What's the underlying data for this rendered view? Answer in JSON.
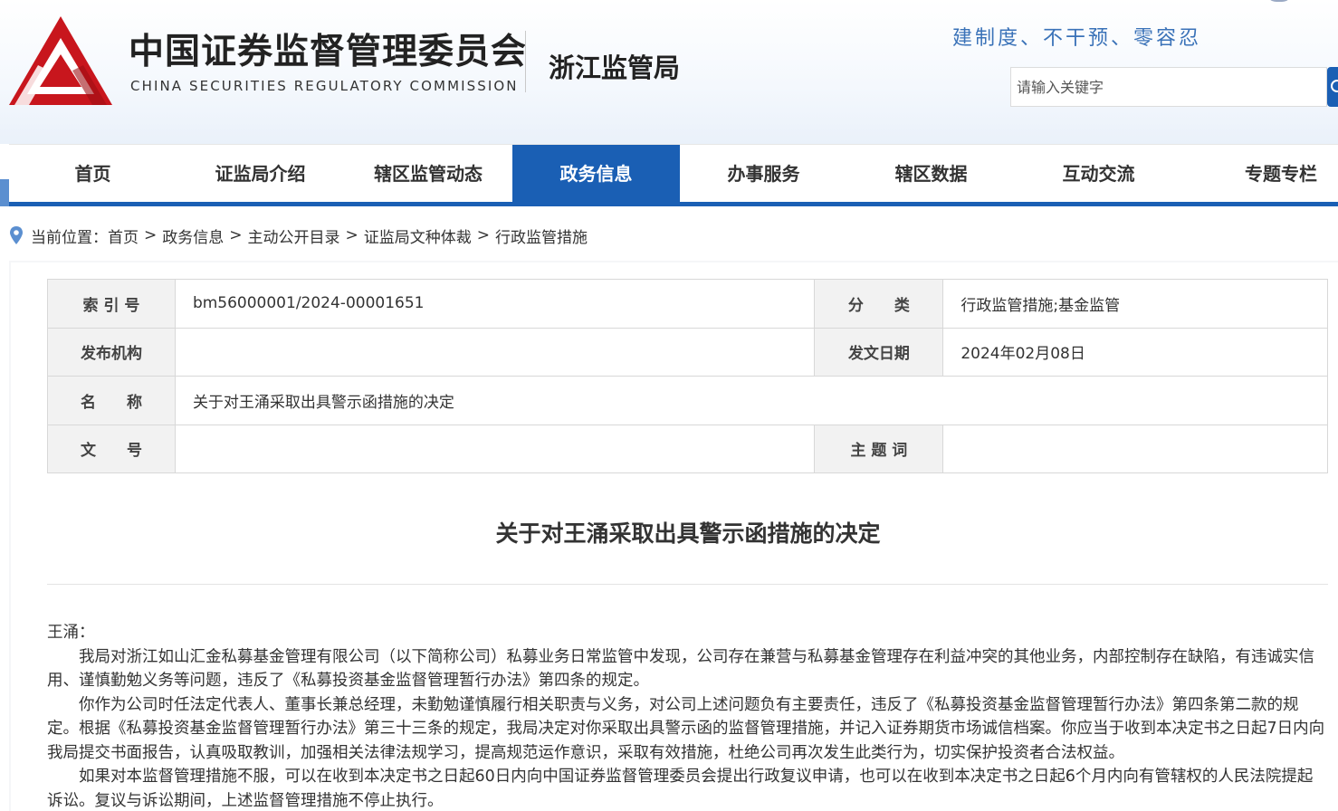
{
  "header": {
    "org_name_cn": "中国证券监督管理委员会",
    "org_name_en": "CHINA SECURITIES REGULATORY COMMISSION",
    "bureau": "浙江监管局",
    "slogan": "建制度、不干预、零容忍",
    "search_placeholder": "请输入关键字",
    "brand_red": "#c8161d",
    "accent_blue": "#1a5fb4"
  },
  "nav": {
    "items": [
      {
        "label": "首页"
      },
      {
        "label": "证监局介绍"
      },
      {
        "label": "辖区监管动态"
      },
      {
        "label": "政务信息",
        "active": true
      },
      {
        "label": "办事服务"
      },
      {
        "label": "辖区数据"
      },
      {
        "label": "互动交流"
      },
      {
        "label": "专题专栏"
      }
    ]
  },
  "breadcrumb": {
    "prefix": "当前位置：",
    "items": [
      "首页",
      "政务信息",
      "主动公开目录",
      "证监局文种体裁",
      "行政监管措施"
    ],
    "separator": ">"
  },
  "info_table": {
    "index_label": "索 引 号",
    "index_value": "bm56000001/2024-00001651",
    "category_label": "分　　类",
    "category_value": "行政监管措施;基金监管",
    "publisher_label": "发布机构",
    "publisher_value": "",
    "date_label": "发文日期",
    "date_value": "2024年02月08日",
    "name_label": "名　　称",
    "name_value": "关于对王涌采取出具警示函措施的决定",
    "docno_label": "文　　号",
    "docno_value": "",
    "keywords_label": "主 题 词",
    "keywords_value": ""
  },
  "article": {
    "title": "关于对王涌采取出具警示函措施的决定",
    "salutation": "王涌：",
    "paragraphs": [
      "我局对浙江如山汇金私募基金管理有限公司（以下简称公司）私募业务日常监管中发现，公司存在兼营与私募基金管理存在利益冲突的其他业务，内部控制存在缺陷，有违诚实信用、谨慎勤勉义务等问题，违反了《私募投资基金监督管理暂行办法》第四条的规定。",
      "你作为公司时任法定代表人、董事长兼总经理，未勤勉谨慎履行相关职责与义务，对公司上述问题负有主要责任，违反了《私募投资基金监督管理暂行办法》第四条第二款的规定。根据《私募投资基金监督管理暂行办法》第三十三条的规定，我局决定对你采取出具警示函的监督管理措施，并记入证券期货市场诚信档案。你应当于收到本决定书之日起7日内向我局提交书面报告，认真吸取教训，加强相关法律法规学习，提高规范运作意识，采取有效措施，杜绝公司再次发生此类行为，切实保护投资者合法权益。",
      "如果对本监督管理措施不服，可以在收到本决定书之日起60日内向中国证券监督管理委员会提出行政复议申请，也可以在收到本决定书之日起6个月内向有管辖权的人民法院提起诉讼。复议与诉讼期间，上述监督管理措施不停止执行。"
    ]
  }
}
